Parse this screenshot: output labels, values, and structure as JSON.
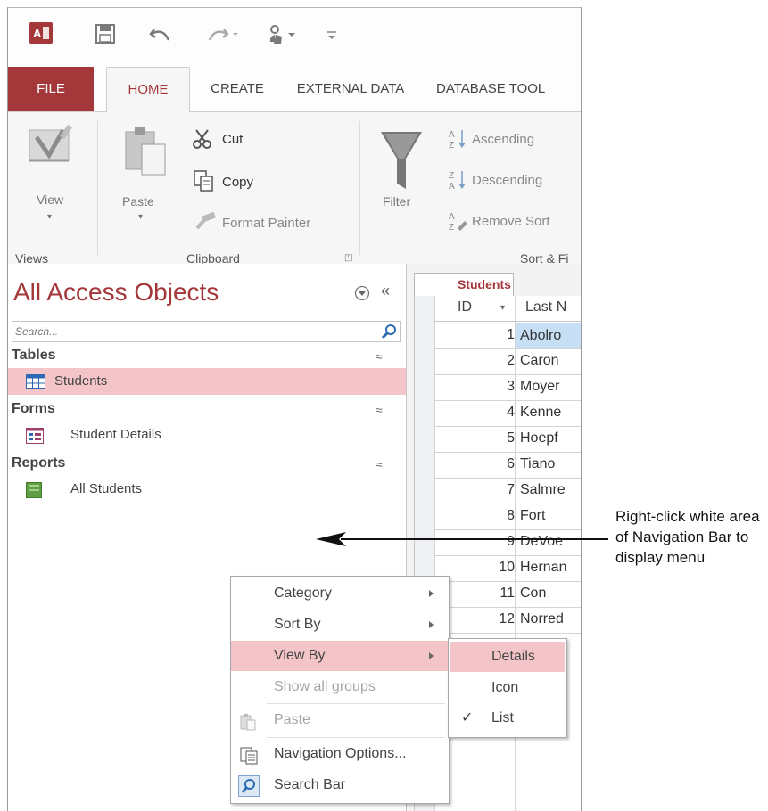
{
  "colors": {
    "accent": "#a4373a",
    "selection": "#f4c5c8",
    "grid_selected": "#c6dff4"
  },
  "tabs": [
    "FILE",
    "HOME",
    "CREATE",
    "EXTERNAL DATA",
    "DATABASE TOOL"
  ],
  "ribbon": {
    "views": {
      "view_label": "View",
      "group": "Views"
    },
    "clipboard": {
      "paste_label": "Paste",
      "cut": "Cut",
      "copy": "Copy",
      "format_painter": "Format Painter",
      "group": "Clipboard"
    },
    "sort": {
      "filter": "Filter",
      "ascending": "Ascending",
      "descending": "Descending",
      "remove_sort": "Remove Sort",
      "group": "Sort & Fi"
    }
  },
  "nav": {
    "title": "All Access Objects",
    "search_placeholder": "Search...",
    "sections": [
      {
        "label": "Tables",
        "items": [
          "Students"
        ]
      },
      {
        "label": "Forms",
        "items": [
          "Student Details"
        ]
      },
      {
        "label": "Reports",
        "items": [
          "All Students"
        ]
      }
    ]
  },
  "table": {
    "tab_label": "Students",
    "columns": [
      "ID",
      "Last N"
    ],
    "rows": [
      {
        "id": "1",
        "last": "Abolro"
      },
      {
        "id": "2",
        "last": "Caron"
      },
      {
        "id": "3",
        "last": "Moyer"
      },
      {
        "id": "4",
        "last": "Kenne"
      },
      {
        "id": "5",
        "last": "Hoepf"
      },
      {
        "id": "6",
        "last": "Tiano"
      },
      {
        "id": "7",
        "last": "Salmre"
      },
      {
        "id": "8",
        "last": "Fort"
      },
      {
        "id": "9",
        "last": "DeVoe"
      },
      {
        "id": "10",
        "last": "Hernan"
      },
      {
        "id": "11",
        "last": "Con"
      },
      {
        "id": "12",
        "last": "Norred"
      }
    ]
  },
  "context_menu": {
    "category": "Category",
    "sort_by": "Sort By",
    "view_by": "View By",
    "show_all_groups": "Show all groups",
    "paste": "Paste",
    "navigation_options": "Navigation Options...",
    "search_bar": "Search Bar"
  },
  "submenu": {
    "details": "Details",
    "icon": "Icon",
    "list": "List"
  },
  "callout": "Right-click white area of Navigation Bar to display menu"
}
